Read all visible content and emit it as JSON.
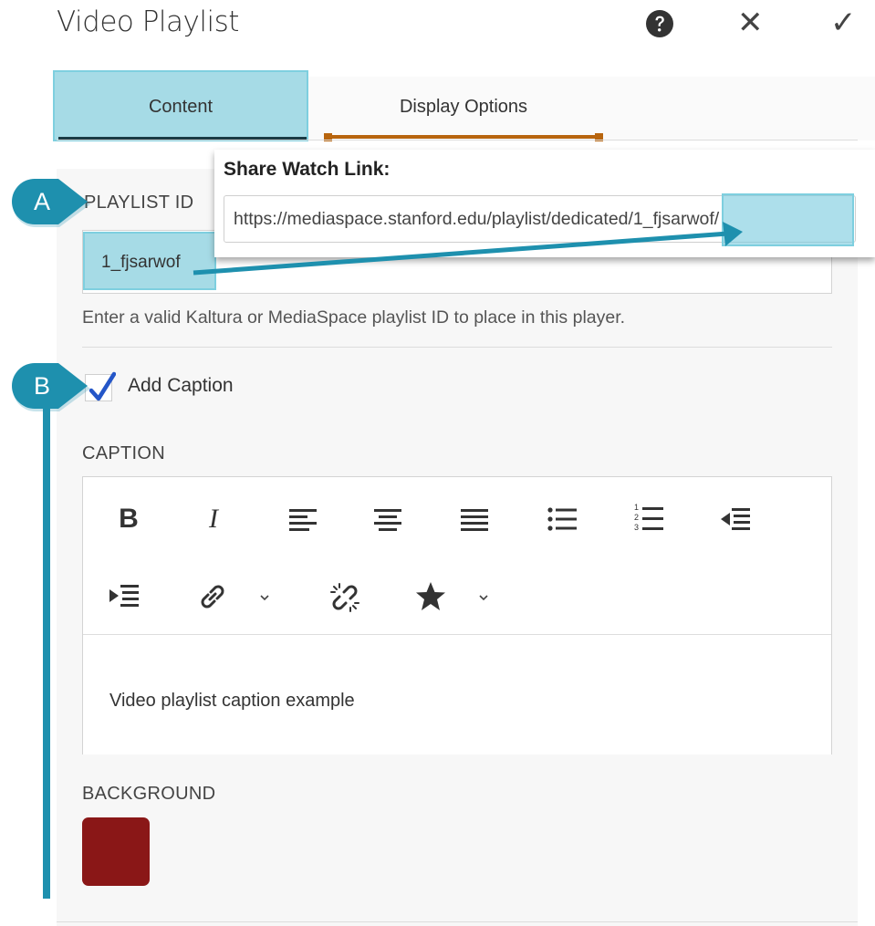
{
  "header": {
    "title": "Video Playlist",
    "help_icon": "question-circle-icon",
    "close_icon": "close-icon",
    "close_glyph": "✕",
    "confirm_icon": "checkmark-icon",
    "confirm_glyph": "✓"
  },
  "tabs": [
    {
      "label": "Content",
      "active": true
    },
    {
      "label": "Display Options",
      "active": false
    }
  ],
  "share_popover": {
    "heading": "Share Watch Link:",
    "url": "https://mediaspace.stanford.edu/playlist/dedicated/1_fjsarwof/"
  },
  "playlist": {
    "label": "PLAYLIST ID",
    "value": "1_fjsarwof",
    "helper": "Enter a valid Kaltura or MediaSpace playlist ID to place in this player."
  },
  "caption_toggle": {
    "label": "Add Caption",
    "checked": true
  },
  "caption": {
    "label": "CAPTION",
    "toolbar": [
      "bold",
      "italic",
      "align-left",
      "align-center",
      "align-right",
      "bulleted-list",
      "numbered-list",
      "outdent",
      "indent",
      "link",
      "unlink",
      "star"
    ],
    "bold_glyph": "B",
    "italic_glyph": "I",
    "text": "Video playlist caption example"
  },
  "background": {
    "label": "BACKGROUND",
    "color": "#8a1717"
  },
  "annotations": {
    "marker_a": "A",
    "marker_b": "B",
    "accent_color": "#1e90ae",
    "highlight_color": "#a6dbe6"
  }
}
